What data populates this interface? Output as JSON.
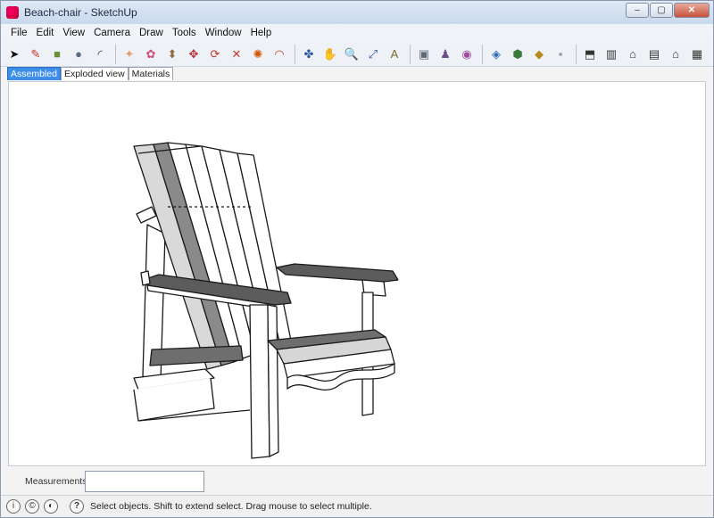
{
  "window": {
    "title": "Beach-chair - SketchUp",
    "controls": {
      "minimize": "–",
      "maximize": "▢",
      "close": "✕"
    }
  },
  "menu": {
    "items": [
      "File",
      "Edit",
      "View",
      "Camera",
      "Draw",
      "Tools",
      "Window",
      "Help"
    ]
  },
  "toolbar": {
    "tools": [
      {
        "name": "select-arrow-icon",
        "glyph": "➤",
        "color": "#111111"
      },
      {
        "name": "pencil-line-icon",
        "glyph": "✎",
        "color": "#c0392b"
      },
      {
        "name": "rectangle-icon",
        "glyph": "■",
        "color": "#6b8f3a"
      },
      {
        "name": "circle-icon",
        "glyph": "●",
        "color": "#5d6d7e"
      },
      {
        "name": "arc-icon",
        "glyph": "◜",
        "color": "#333333"
      },
      {
        "name": "eraser-icon",
        "glyph": "✦",
        "color": "#e0a070"
      },
      {
        "name": "paint-bucket-icon",
        "glyph": "✿",
        "color": "#d04a7a"
      },
      {
        "name": "push-pull-icon",
        "glyph": "⬍",
        "color": "#8a6d3b"
      },
      {
        "name": "move-icon",
        "glyph": "✥",
        "color": "#b03030"
      },
      {
        "name": "rotate-icon",
        "glyph": "⟳",
        "color": "#c0392b"
      },
      {
        "name": "scale-icon",
        "glyph": "✕",
        "color": "#c0392b"
      },
      {
        "name": "follow-me-icon",
        "glyph": "✺",
        "color": "#d35400"
      },
      {
        "name": "offset-icon",
        "glyph": "◠",
        "color": "#c0392b"
      },
      {
        "name": "orbit-icon",
        "glyph": "✤",
        "color": "#2c5aa0"
      },
      {
        "name": "pan-icon",
        "glyph": "✋",
        "color": "#2c5aa0"
      },
      {
        "name": "zoom-icon",
        "glyph": "🔍",
        "color": "#2c5aa0"
      },
      {
        "name": "zoom-extents-icon",
        "glyph": "⤢",
        "color": "#2c5aa0"
      },
      {
        "name": "text-icon",
        "glyph": "A",
        "color": "#7a6b2a"
      },
      {
        "name": "section-plane-icon",
        "glyph": "▣",
        "color": "#5f6a78"
      },
      {
        "name": "walk-icon",
        "glyph": "♟",
        "color": "#6b4f8a"
      },
      {
        "name": "look-around-icon",
        "glyph": "◉",
        "color": "#9c4a9c"
      },
      {
        "name": "components-icon",
        "glyph": "◈",
        "color": "#2c6bbf"
      },
      {
        "name": "warehouse-icon",
        "glyph": "⬢",
        "color": "#3c7a3c"
      },
      {
        "name": "materials-icon",
        "glyph": "◆",
        "color": "#b58a1a"
      },
      {
        "name": "styles-icon",
        "glyph": "▪",
        "color": "#999999"
      },
      {
        "name": "iso-view-icon",
        "glyph": "⬒",
        "color": "#333333"
      },
      {
        "name": "top-view-icon",
        "glyph": "▥",
        "color": "#333333"
      },
      {
        "name": "front-view-icon",
        "glyph": "⌂",
        "color": "#333333"
      },
      {
        "name": "right-view-icon",
        "glyph": "▤",
        "color": "#333333"
      },
      {
        "name": "back-view-icon",
        "glyph": "⌂",
        "color": "#333333"
      },
      {
        "name": "left-view-icon",
        "glyph": "▦",
        "color": "#333333"
      }
    ]
  },
  "tabs": [
    {
      "label": "Assembled",
      "active": true
    },
    {
      "label": "Exploded view",
      "active": false
    },
    {
      "label": "Materials",
      "active": false
    }
  ],
  "measurements": {
    "label": "Measurements",
    "value": ""
  },
  "status": {
    "text": "Select objects. Shift to extend select. Drag mouse to select multiple."
  }
}
